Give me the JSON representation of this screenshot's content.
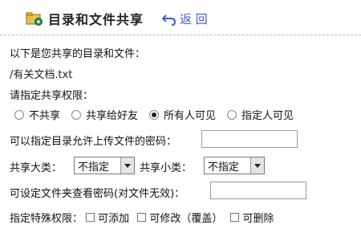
{
  "header": {
    "title": "目录和文件共享",
    "back_label": "返 回"
  },
  "intro_text": "以下是您共享的目录和文件：",
  "shared_file": "/有关文档.txt",
  "permission_heading": "请指定共享权限：",
  "share_options": [
    {
      "label": "不共享",
      "selected": false
    },
    {
      "label": "共享给好友",
      "selected": false
    },
    {
      "label": "所有人可见",
      "selected": true
    },
    {
      "label": "指定人可见",
      "selected": false
    }
  ],
  "upload_password": {
    "label": "可以指定目录允许上传文件的密码：",
    "value": ""
  },
  "category": {
    "major_label": "共享大类：",
    "major_value": "不指定",
    "minor_label": "共享小类：",
    "minor_value": "不指定"
  },
  "view_password": {
    "label": "可设定文件夹查看密码(对文件无效)：",
    "value": ""
  },
  "special_permissions": {
    "label": "指定特殊权限：",
    "options": [
      {
        "label": "可添加",
        "checked": false
      },
      {
        "label": "可修改（覆盖）",
        "checked": false
      },
      {
        "label": "可删除",
        "checked": false
      }
    ]
  },
  "colors": {
    "link_blue": "#3a5fcd",
    "icon_green": "#2e8b57",
    "folder_yellow": "#e8c24a"
  },
  "icons": {
    "header": "shared-folder-icon",
    "back": "return-arrow-icon"
  }
}
